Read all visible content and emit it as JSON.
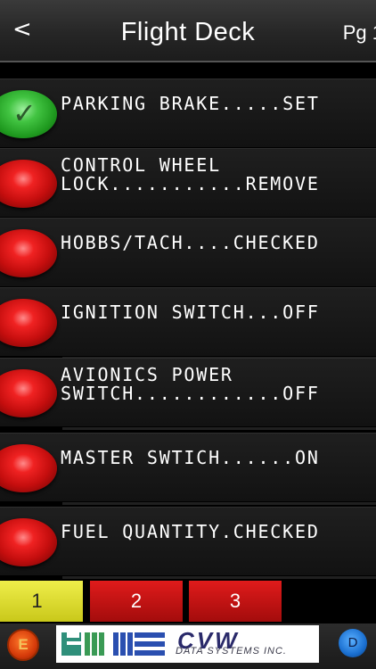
{
  "header": {
    "back_label": "<",
    "title": "Flight Deck",
    "page_label": "Pg 1"
  },
  "checklist": [
    {
      "line1": "PARKING BRAKE.....SET",
      "line2": "",
      "status": "checked",
      "color": "#2fb12f"
    },
    {
      "line1": "CONTROL WHEEL",
      "line2": "LOCK...........REMOVE",
      "status": "unchecked",
      "color": "#d01212"
    },
    {
      "line1": "HOBBS/TACH....CHECKED",
      "line2": "",
      "status": "unchecked",
      "color": "#d01212"
    },
    {
      "line1": "IGNITION SWITCH...OFF",
      "line2": "",
      "status": "unchecked",
      "color": "#d01212"
    },
    {
      "line1": "AVIONICS POWER",
      "line2": "SWITCH............OFF",
      "status": "unchecked",
      "color": "#d01212"
    },
    {
      "line1": "MASTER SWTICH......ON",
      "line2": "",
      "status": "unchecked",
      "color": "#d01212"
    },
    {
      "line1": "FUEL QUANTITY.CHECKED",
      "line2": "",
      "status": "unchecked",
      "color": "#d01212"
    }
  ],
  "check_icon": "✓",
  "tabs": [
    {
      "label": "1",
      "active": true,
      "color": "#dedd2e"
    },
    {
      "label": "2",
      "active": false,
      "color": "#c41414"
    },
    {
      "label": "3",
      "active": false,
      "color": "#c41414"
    }
  ],
  "footer": {
    "left_button": "E",
    "logo_text": "CVW",
    "logo_subtext": "DATA SYSTEMS INC.",
    "right_button": "D"
  }
}
